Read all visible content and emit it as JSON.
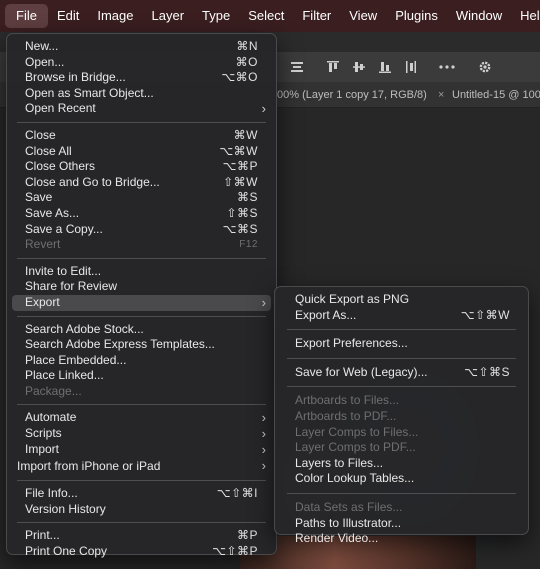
{
  "menubar": {
    "items": [
      "File",
      "Edit",
      "Image",
      "Layer",
      "Type",
      "Select",
      "Filter",
      "View",
      "Plugins",
      "Window",
      "Help"
    ]
  },
  "tabs": {
    "tab1": "00% (Layer 1 copy 17, RGB/8)",
    "tab2_close": "×",
    "tab2": "Untitled-15 @ 100"
  },
  "file_menu": {
    "group1": [
      {
        "label": "New...",
        "shortcut": "⌘N"
      },
      {
        "label": "Open...",
        "shortcut": "⌘O"
      },
      {
        "label": "Browse in Bridge...",
        "shortcut": "⌥⌘O"
      },
      {
        "label": "Open as Smart Object...",
        "shortcut": ""
      },
      {
        "label": "Open Recent",
        "shortcut": ""
      }
    ],
    "group2": [
      {
        "label": "Close",
        "shortcut": "⌘W"
      },
      {
        "label": "Close All",
        "shortcut": "⌥⌘W"
      },
      {
        "label": "Close Others",
        "shortcut": "⌥⌘P"
      },
      {
        "label": "Close and Go to Bridge...",
        "shortcut": "⇧⌘W"
      },
      {
        "label": "Save",
        "shortcut": "⌘S"
      },
      {
        "label": "Save As...",
        "shortcut": "⇧⌘S"
      },
      {
        "label": "Save a Copy...",
        "shortcut": "⌥⌘S"
      },
      {
        "label": "Revert",
        "shortcut": "F12"
      }
    ],
    "group3": [
      {
        "label": "Invite to Edit..."
      },
      {
        "label": "Share for Review"
      },
      {
        "label": "Export"
      }
    ],
    "group4": [
      {
        "label": "Search Adobe Stock..."
      },
      {
        "label": "Search Adobe Express Templates..."
      },
      {
        "label": "Place Embedded..."
      },
      {
        "label": "Place Linked..."
      },
      {
        "label": "Package..."
      }
    ],
    "group5": [
      {
        "label": "Automate"
      },
      {
        "label": "Scripts"
      },
      {
        "label": "Import"
      },
      {
        "label": "Import from iPhone or iPad"
      }
    ],
    "group6": [
      {
        "label": "File Info...",
        "shortcut": "⌥⇧⌘I"
      },
      {
        "label": "Version History",
        "shortcut": ""
      }
    ],
    "group7": [
      {
        "label": "Print...",
        "shortcut": "⌘P"
      },
      {
        "label": "Print One Copy",
        "shortcut": "⌥⇧⌘P"
      }
    ]
  },
  "export_menu": {
    "group1": [
      {
        "label": "Quick Export as PNG",
        "shortcut": ""
      },
      {
        "label": "Export As...",
        "shortcut": "⌥⇧⌘W"
      }
    ],
    "group2": [
      {
        "label": "Export Preferences..."
      }
    ],
    "group3": [
      {
        "label": "Save for Web (Legacy)...",
        "shortcut": "⌥⇧⌘S"
      }
    ],
    "group4": [
      {
        "label": "Artboards to Files..."
      },
      {
        "label": "Artboards to PDF..."
      },
      {
        "label": "Layer Comps to Files..."
      },
      {
        "label": "Layer Comps to PDF..."
      },
      {
        "label": "Layers to Files..."
      },
      {
        "label": "Color Lookup Tables..."
      }
    ],
    "group5": [
      {
        "label": "Data Sets as Files..."
      },
      {
        "label": "Paths to Illustrator..."
      },
      {
        "label": "Render Video..."
      }
    ]
  },
  "icons": {
    "submenu_arrow": "chevron-right-icon",
    "more": "more-icon",
    "settings": "gear-icon"
  },
  "colors": {
    "menubar_bg": "#3a1e20",
    "menu_bg": "#262628",
    "highlight": "#4a4a4c",
    "disabled_text": "#6f6f6f"
  }
}
